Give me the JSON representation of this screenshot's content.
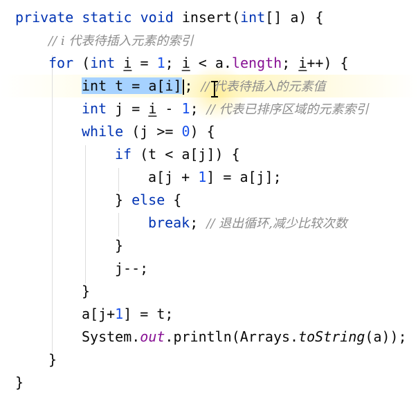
{
  "code": {
    "l1": {
      "a": "private",
      "b": " ",
      "c": "static",
      "d": " ",
      "e": "void",
      "f": " insert(",
      "g": "int",
      "h": "[] a) {"
    },
    "l2": {
      "comment": "// i 代表待插入元素的索引"
    },
    "l3": {
      "for": "for",
      "p1": " (",
      "int": "int",
      "s1": " ",
      "i1": "i",
      "s2": " = ",
      "one": "1",
      "s3": "; ",
      "i2": "i",
      "s4": " < a.",
      "len": "length",
      "s5": "; ",
      "i3": "i",
      "s6": "++) {"
    },
    "l4": {
      "sel": "int t = a[i]",
      "after": "; ",
      "comment": "// 代表待插入的元素值"
    },
    "l5": {
      "int": "int",
      "s1": " j = ",
      "i": "i",
      "s2": " - ",
      "one": "1",
      "s3": "; ",
      "comment": "// 代表已排序区域的元素索引"
    },
    "l6": {
      "while": "while",
      "s1": " (j >= ",
      "zero": "0",
      "s2": ") {"
    },
    "l7": {
      "if": "if",
      "s1": " (t < a[j]) {"
    },
    "l8": {
      "s1": "a[j + ",
      "one": "1",
      "s2": "] = a[j];"
    },
    "l9": {
      "s1": "} ",
      "else": "else",
      "s2": " {"
    },
    "l10": {
      "break": "break",
      "s1": "; ",
      "comment": "// 退出循环,减少比较次数"
    },
    "l11": {
      "s1": "}"
    },
    "l12": {
      "s1": "j--;"
    },
    "l13": {
      "s1": "}"
    },
    "l14": {
      "s1": "a[j+",
      "one": "1",
      "s2": "] = t;"
    },
    "l15": {
      "s1": "System.",
      "out": "out",
      "s2": ".println(Arrays.",
      "ts": "toString",
      "s3": "(a));"
    },
    "l16": {
      "s1": "}"
    },
    "l17": {
      "s1": "}"
    }
  },
  "colors": {
    "keyword": "#0033b3",
    "number": "#1750eb",
    "field": "#871094",
    "comment": "#8c8c8c",
    "selection": "#a6d2ff",
    "current_line": "#fff7c6"
  },
  "cursor": {
    "type": "i-beam-cursor"
  }
}
